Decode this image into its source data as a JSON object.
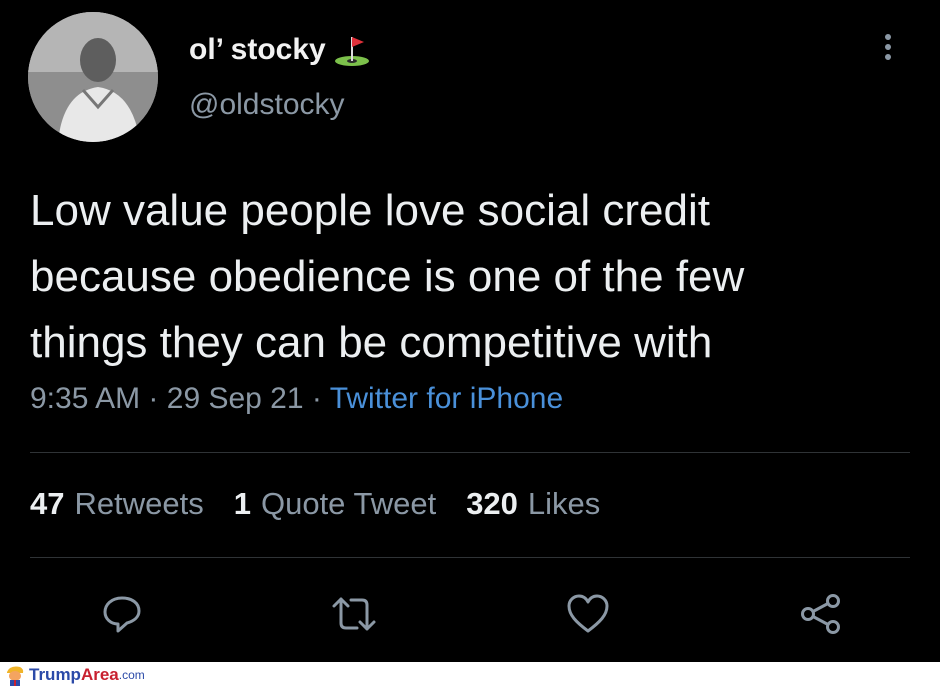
{
  "tweet": {
    "display_name": "ol’ stocky",
    "name_emoji": "flag-in-hole-icon",
    "handle": "@oldstocky",
    "text": "Low value people love social credit\nbecause obedience is one of the few\nthings they can be competitive with",
    "time": "9:35 AM",
    "separator": "·",
    "date": "29 Sep 21",
    "source": "Twitter for iPhone"
  },
  "stats": {
    "retweets_count": "47",
    "retweets_label": "Retweets",
    "quotes_count": "1",
    "quotes_label": "Quote Tweet",
    "likes_count": "320",
    "likes_label": "Likes"
  },
  "actions": [
    "reply-icon",
    "retweet-icon",
    "like-icon",
    "share-icon"
  ],
  "footer": {
    "brand_part1": "Trump",
    "brand_part2": "Area",
    "brand_part3": ".com"
  },
  "colors": {
    "background": "#000000",
    "muted": "#8b98a5",
    "link": "#4a90d9"
  }
}
